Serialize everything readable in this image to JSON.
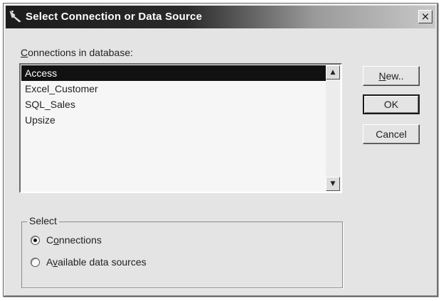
{
  "dialog": {
    "title": "Select Connection or Data Source",
    "close_glyph": "×"
  },
  "connections": {
    "label_prefix": "C",
    "label_rest": "onnections in database:",
    "items": [
      {
        "label": "Access",
        "selected": true
      },
      {
        "label": "Excel_Customer",
        "selected": false
      },
      {
        "label": "SQL_Sales",
        "selected": false
      },
      {
        "label": "Upsize",
        "selected": false
      }
    ],
    "scroll_up_glyph": "▲",
    "scroll_down_glyph": "▼"
  },
  "buttons": {
    "new_prefix": "N",
    "new_rest": "ew..",
    "ok": "OK",
    "cancel": "Cancel"
  },
  "select_group": {
    "title": "Select",
    "options": [
      {
        "before": "C",
        "underlined": "o",
        "after": "nnections",
        "checked": true
      },
      {
        "before": "A",
        "underlined": "v",
        "after": "ailable data sources",
        "checked": false
      }
    ]
  },
  "icons": {
    "app": "wand-app-icon",
    "close": "close-icon",
    "scroll_up": "arrow-up-icon",
    "scroll_down": "arrow-down-icon",
    "radio": "radio-button"
  }
}
